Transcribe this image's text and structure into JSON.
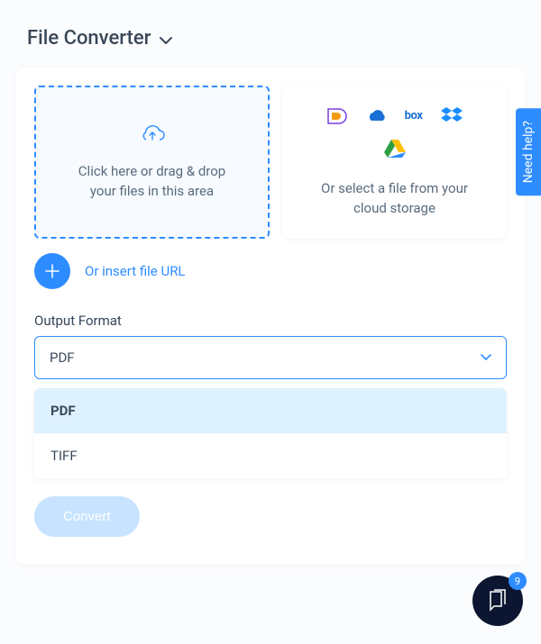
{
  "header": {
    "title": "File Converter"
  },
  "drop": {
    "line1": "Click here or drag & drop",
    "line2": "your files in this area"
  },
  "cloud": {
    "line1": "Or select a file from your",
    "line2": "cloud storage",
    "providers": [
      "dynamsoft",
      "onedrive",
      "box",
      "dropbox",
      "google-drive"
    ]
  },
  "url": {
    "label": "Or insert file URL"
  },
  "output": {
    "label": "Output Format",
    "selected": "PDF",
    "options": [
      "PDF",
      "TIFF"
    ]
  },
  "convert": {
    "label": "Convert"
  },
  "help": {
    "label": "Need help?"
  },
  "chat": {
    "badge": "9"
  }
}
